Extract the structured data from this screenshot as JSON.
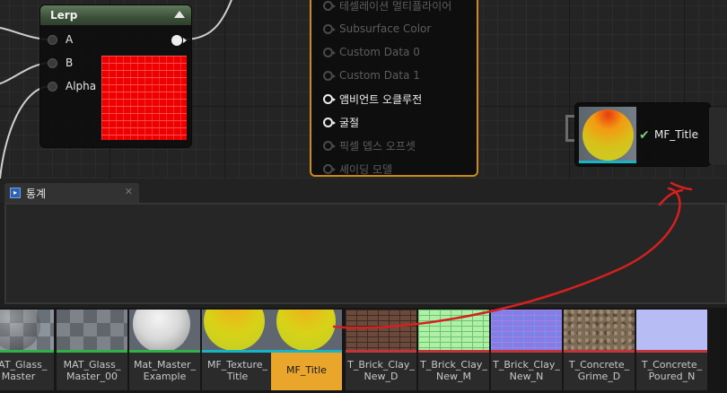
{
  "lerp_node": {
    "title": "Lerp",
    "inputs": [
      "A",
      "B",
      "Alpha"
    ],
    "color": "#3c5139"
  },
  "material_node": {
    "accent": "#d08a17",
    "pins": [
      {
        "label": "테셀레이션 멀티플라이어",
        "active": false
      },
      {
        "label": "Subsurface Color",
        "active": false
      },
      {
        "label": "Custom Data 0",
        "active": false
      },
      {
        "label": "Custom Data 1",
        "active": false
      },
      {
        "label": "앰비언트 오클루전",
        "active": true
      },
      {
        "label": "굴절",
        "active": true
      },
      {
        "label": "픽셀 뎁스 오프셋",
        "active": false
      },
      {
        "label": "셰이딩 모델",
        "active": false
      }
    ]
  },
  "mf_node": {
    "label": "MF_Title",
    "check_icon": "checkmark-icon"
  },
  "stats_panel": {
    "tab_label": "통계",
    "close_glyph": "✕",
    "icon": "stats-icon"
  },
  "assets": [
    {
      "label": "MAT_Glass_\nMaster",
      "bar": "#2db34a",
      "kind": "checker-sphere"
    },
    {
      "label": "MAT_Glass_\nMaster_00",
      "bar": "#2db34a",
      "kind": "checker"
    },
    {
      "label": "Mat_Master_\nExample",
      "bar": "#2db34a",
      "kind": "white-sphere"
    },
    {
      "label": "MF_Texture_\nTitle",
      "bar": "#16b4c4",
      "kind": "yellow-sphere"
    },
    {
      "label": "MF_Title",
      "bar": "#16b4c4",
      "kind": "yellow-sphere",
      "selected": true
    },
    {
      "label": "T_Brick_Clay_\nNew_D",
      "bar": "#c0353a",
      "kind": "brick-brown"
    },
    {
      "label": "T_Brick_Clay_\nNew_M",
      "bar": "#c0353a",
      "kind": "brick-green"
    },
    {
      "label": "T_Brick_Clay_\nNew_N",
      "bar": "#c0353a",
      "kind": "brick-blue"
    },
    {
      "label": "T_Concrete_\nGrime_D",
      "bar": "#c0353a",
      "kind": "concrete"
    },
    {
      "label": "T_Concrete_\nPoured_N",
      "bar": "#c0353a",
      "kind": "flat-blue"
    }
  ]
}
